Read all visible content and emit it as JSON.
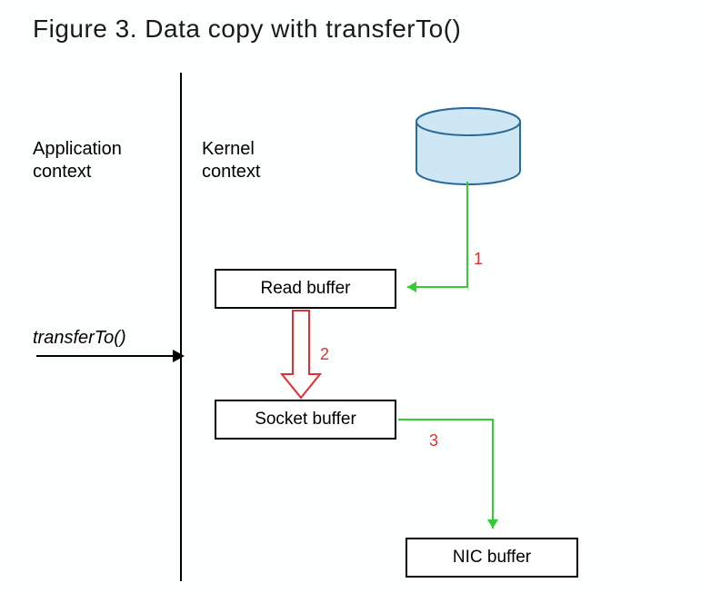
{
  "title": "Figure 3. Data copy with transferTo()",
  "labels": {
    "app_context_l1": "Application",
    "app_context_l2": "context",
    "kernel_context_l1": "Kernel",
    "kernel_context_l2": "context",
    "transfer_to": "transferTo()"
  },
  "boxes": {
    "read_buffer": "Read buffer",
    "socket_buffer": "Socket buffer",
    "nic_buffer": "NIC buffer"
  },
  "flow_numbers": {
    "n1": "1",
    "n2": "2",
    "n3": "3"
  },
  "flows": [
    {
      "from": "disk",
      "to": "read_buffer",
      "label": "1",
      "color": "green"
    },
    {
      "from": "read_buffer",
      "to": "socket_buffer",
      "label": "2",
      "color": "red"
    },
    {
      "from": "socket_buffer",
      "to": "nic_buffer",
      "label": "3",
      "color": "green"
    }
  ]
}
